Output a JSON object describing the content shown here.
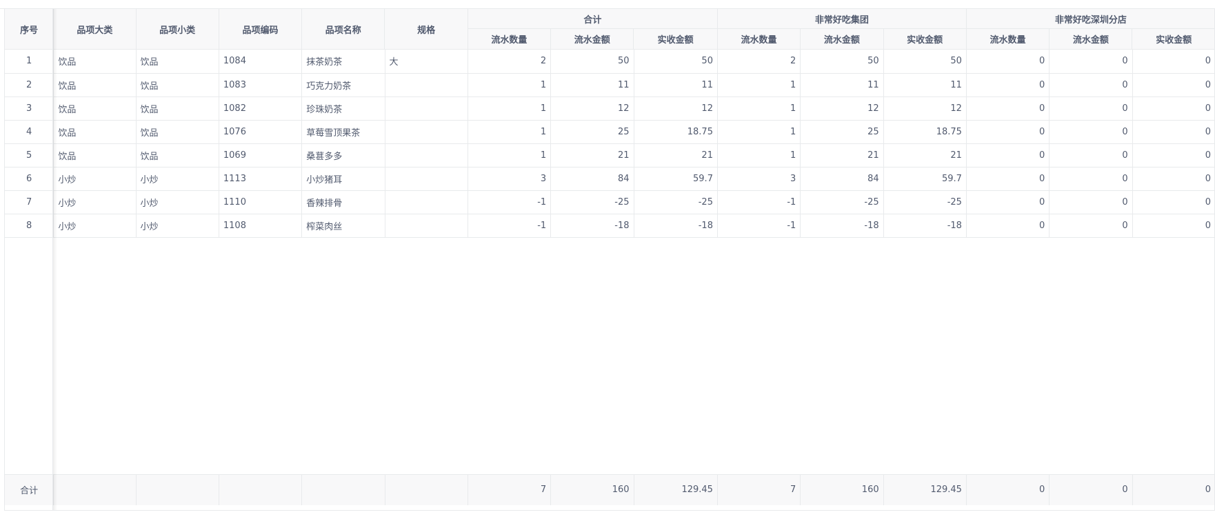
{
  "headers": {
    "index": "序号",
    "category": "品项大类",
    "subcategory": "品项小类",
    "code": "品项编码",
    "name": "品项名称",
    "spec": "规格",
    "groups": [
      {
        "title": "合计",
        "cols": [
          "流水数量",
          "流水金额",
          "实收金额"
        ]
      },
      {
        "title": "非常好吃集团",
        "cols": [
          "流水数量",
          "流水金额",
          "实收金额"
        ]
      },
      {
        "title": "非常好吃深圳分店",
        "cols": [
          "流水数量",
          "流水金额",
          "实收金额"
        ]
      }
    ]
  },
  "rows": [
    {
      "index": "1",
      "category": "饮品",
      "subcategory": "饮品",
      "code": "1084",
      "name": "抹茶奶茶",
      "spec": "大",
      "values": [
        "2",
        "50",
        "50",
        "2",
        "50",
        "50",
        "0",
        "0",
        "0"
      ]
    },
    {
      "index": "2",
      "category": "饮品",
      "subcategory": "饮品",
      "code": "1083",
      "name": "巧克力奶茶",
      "spec": "",
      "values": [
        "1",
        "11",
        "11",
        "1",
        "11",
        "11",
        "0",
        "0",
        "0"
      ]
    },
    {
      "index": "3",
      "category": "饮品",
      "subcategory": "饮品",
      "code": "1082",
      "name": "珍珠奶茶",
      "spec": "",
      "values": [
        "1",
        "12",
        "12",
        "1",
        "12",
        "12",
        "0",
        "0",
        "0"
      ]
    },
    {
      "index": "4",
      "category": "饮品",
      "subcategory": "饮品",
      "code": "1076",
      "name": "草莓雪顶果茶",
      "spec": "",
      "values": [
        "1",
        "25",
        "18.75",
        "1",
        "25",
        "18.75",
        "0",
        "0",
        "0"
      ]
    },
    {
      "index": "5",
      "category": "饮品",
      "subcategory": "饮品",
      "code": "1069",
      "name": "桑葚多多",
      "spec": "",
      "values": [
        "1",
        "21",
        "21",
        "1",
        "21",
        "21",
        "0",
        "0",
        "0"
      ]
    },
    {
      "index": "6",
      "category": "小炒",
      "subcategory": "小炒",
      "code": "1113",
      "name": "小炒猪耳",
      "spec": "",
      "values": [
        "3",
        "84",
        "59.7",
        "3",
        "84",
        "59.7",
        "0",
        "0",
        "0"
      ]
    },
    {
      "index": "7",
      "category": "小炒",
      "subcategory": "小炒",
      "code": "1110",
      "name": "香辣排骨",
      "spec": "",
      "values": [
        "-1",
        "-25",
        "-25",
        "-1",
        "-25",
        "-25",
        "0",
        "0",
        "0"
      ]
    },
    {
      "index": "8",
      "category": "小炒",
      "subcategory": "小炒",
      "code": "1108",
      "name": "榨菜肉丝",
      "spec": "",
      "values": [
        "-1",
        "-18",
        "-18",
        "-1",
        "-18",
        "-18",
        "0",
        "0",
        "0"
      ]
    }
  ],
  "footer": {
    "label": "合计",
    "values": [
      "7",
      "160",
      "129.45",
      "7",
      "160",
      "129.45",
      "0",
      "0",
      "0"
    ]
  }
}
